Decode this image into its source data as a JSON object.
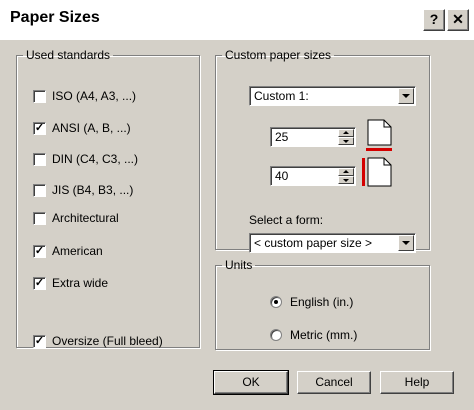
{
  "window": {
    "title": "Paper Sizes",
    "help_glyph": "?",
    "close_glyph": "✕"
  },
  "used_standards": {
    "legend": "Used standards",
    "items": [
      {
        "label": "ISO (A4, A3, ...)",
        "checked": false
      },
      {
        "label": "ANSI (A, B, ...)",
        "checked": true
      },
      {
        "label": "DIN (C4, C3, ...)",
        "checked": false
      },
      {
        "label": "JIS (B4, B3, ...)",
        "checked": false
      },
      {
        "label": "Architectural",
        "checked": false
      },
      {
        "label": "American",
        "checked": true
      },
      {
        "label": "Extra wide",
        "checked": true
      },
      {
        "label": "Oversize (Full bleed)",
        "checked": true
      }
    ]
  },
  "custom": {
    "legend": "Custom paper sizes",
    "selected": "Custom 1:",
    "width_value": "25",
    "height_value": "40",
    "form_label": "Select a form:",
    "form_selected": "< custom paper size >"
  },
  "units": {
    "legend": "Units",
    "options": [
      {
        "label": "English (in.)",
        "selected": true
      },
      {
        "label": "Metric (mm.)",
        "selected": false
      }
    ]
  },
  "buttons": {
    "ok": "OK",
    "cancel": "Cancel",
    "help": "Help"
  },
  "colors": {
    "dimension_marker": "#d40000"
  }
}
